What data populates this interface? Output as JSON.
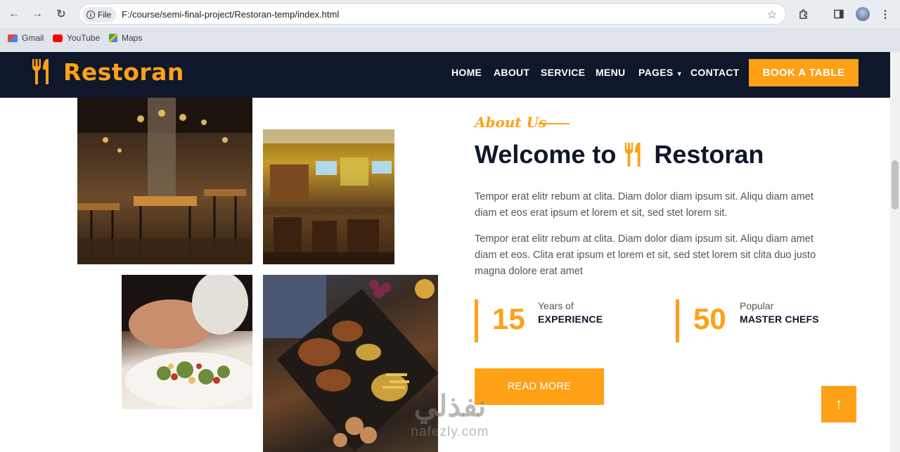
{
  "browser": {
    "chip_label": "File",
    "url": "F:/course/semi-final-project/Restoran-temp/index.html",
    "bookmarks": [
      {
        "label": "Gmail",
        "icon": "gmail-icon"
      },
      {
        "label": "YouTube",
        "icon": "youtube-icon"
      },
      {
        "label": "Maps",
        "icon": "maps-icon"
      }
    ]
  },
  "site": {
    "brand": "Restoran",
    "menu": [
      "HOME",
      "ABOUT",
      "SERVICE",
      "MENU",
      "PAGES",
      "CONTACT"
    ],
    "book_button": "BOOK A TABLE",
    "about_label": "About Us",
    "title_prefix": "Welcome to",
    "title_brand": "Restoran",
    "paragraph_1": "Tempor erat elitr rebum at clita. Diam dolor diam ipsum sit. Aliqu diam amet diam et eos erat ipsum et lorem et sit, sed stet lorem sit.",
    "paragraph_2": "Tempor erat elitr rebum at clita. Diam dolor diam ipsum sit. Aliqu diam amet diam et eos. Clita erat ipsum et lorem et sit, sed stet lorem sit clita duo justo magna dolore erat amet",
    "stats": [
      {
        "number": "15",
        "top": "Years of",
        "bottom": "EXPERIENCE"
      },
      {
        "number": "50",
        "top": "Popular",
        "bottom": "MASTER CHEFS"
      }
    ],
    "read_more": "READ MORE",
    "back_to_top": "↑"
  },
  "watermark": {
    "arabic": "نفذلي",
    "latin": "nafezly.com"
  },
  "colors": {
    "accent": "#fea116",
    "dark": "#0f172b"
  }
}
